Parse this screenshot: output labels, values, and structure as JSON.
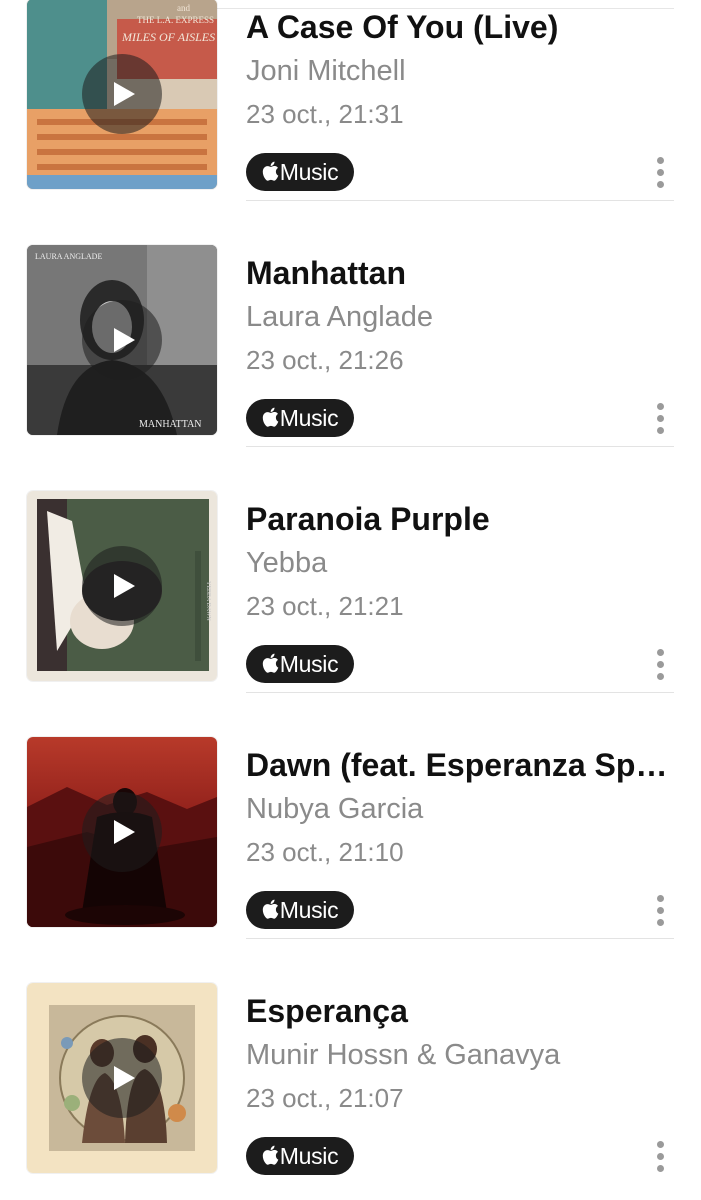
{
  "badge_label": "Music",
  "tracks": [
    {
      "title": "A Case Of You (Live)",
      "artist": "Joni Mitchell",
      "time": "23 oct., 21:31",
      "cover_text": [
        "and",
        "THE L.A. EXPRESS",
        "MILES OF AISLES"
      ]
    },
    {
      "title": "Manhattan",
      "artist": "Laura Anglade",
      "time": "23 oct., 21:26",
      "cover_text": [
        "LAURA ANGLADE",
        "MANHATTAN"
      ]
    },
    {
      "title": "Paranoia Purple",
      "artist": "Yebba",
      "time": "23 oct., 21:21",
      "cover_text": [
        "YEBBA DAWN"
      ]
    },
    {
      "title": "Dawn (feat. Esperanza Spalding)",
      "artist": "Nubya Garcia",
      "time": "23 oct., 21:10",
      "cover_text": []
    },
    {
      "title": "Esperança",
      "artist": "Munir Hossn & Ganavya",
      "time": "23 oct., 21:07",
      "cover_text": []
    }
  ],
  "colors": {
    "badge_bg": "#1c1c1c",
    "secondary_text": "#8a8a8a",
    "divider": "#e3e3e3"
  },
  "icons": [
    "play-icon",
    "apple-logo-icon",
    "more-vertical-icon"
  ]
}
